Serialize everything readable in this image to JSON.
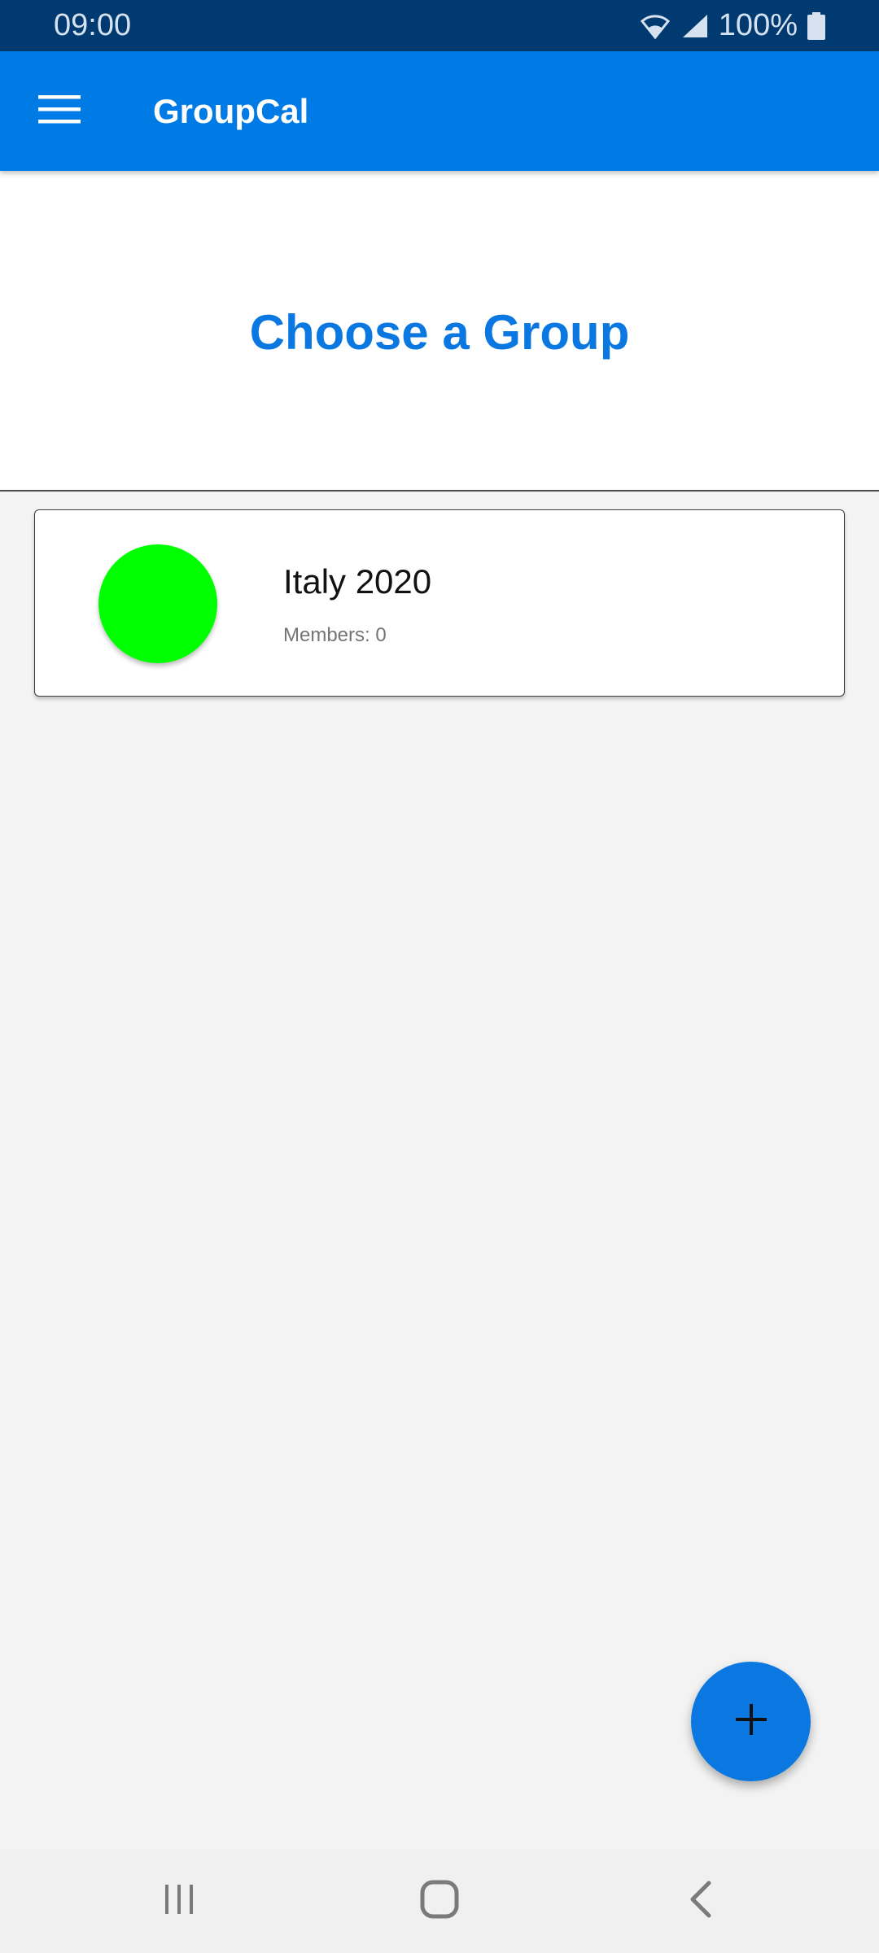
{
  "status_bar": {
    "time": "09:00",
    "battery": "100%",
    "icons": [
      "wifi-icon",
      "signal-icon",
      "battery-icon"
    ]
  },
  "app_bar": {
    "title": "GroupCal",
    "menu_icon": "hamburger-menu-icon",
    "color": "#007ae5"
  },
  "header": {
    "title": "Choose a Group",
    "color": "#0a78e0"
  },
  "groups": [
    {
      "name": "Italy 2020",
      "members": "Members: 0",
      "color": "#00ff00"
    }
  ],
  "fab": {
    "icon": "plus-icon",
    "color": "#0a78e0"
  },
  "nav_bar": {
    "icons": [
      "recent-apps-icon",
      "home-icon",
      "back-icon"
    ]
  }
}
